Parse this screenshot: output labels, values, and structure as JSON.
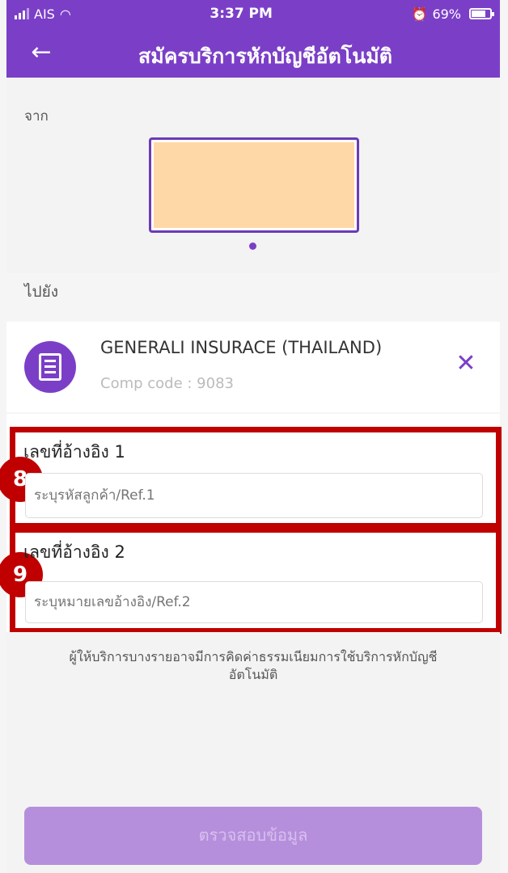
{
  "status_bar": {
    "carrier": "AIS",
    "time": "3:37 PM",
    "battery": "69%",
    "icons": [
      "signal-icon",
      "wifi-icon",
      "alarm-icon",
      "battery-icon"
    ]
  },
  "header": {
    "title": "สมัครบริการหักบัญชีอัตโนมัติ",
    "back_icon": "arrow-left-icon"
  },
  "from": {
    "label": "จาก"
  },
  "to": {
    "label": "ไปยัง"
  },
  "biller": {
    "name": "GENERALI INSURACE (THAILAND)",
    "code": "Comp code : 9083",
    "icon": "document-icon",
    "close_icon": "close-icon"
  },
  "references": [
    {
      "step": "8",
      "label": "เลขที่อ้างอิง 1",
      "placeholder": "ระบุรหัสลูกค้า/Ref.1",
      "value": ""
    },
    {
      "step": "9",
      "label": "เลขที่อ้างอิง 2",
      "placeholder": "ระบุหมายเลขอ้างอิง/Ref.2",
      "value": ""
    }
  ],
  "notice": "ผู้ให้บริการบางรายอาจมีการคิดค่าธรรมเนียมการใช้บริการหักบัญชีอัตโนมัติ",
  "confirm_button": "ตรวจสอบข้อมูล",
  "colors": {
    "primary": "#7b3fc7",
    "highlight": "#c00000",
    "button_disabled": "#b68fdc",
    "account_card": "#ffd8a8"
  }
}
